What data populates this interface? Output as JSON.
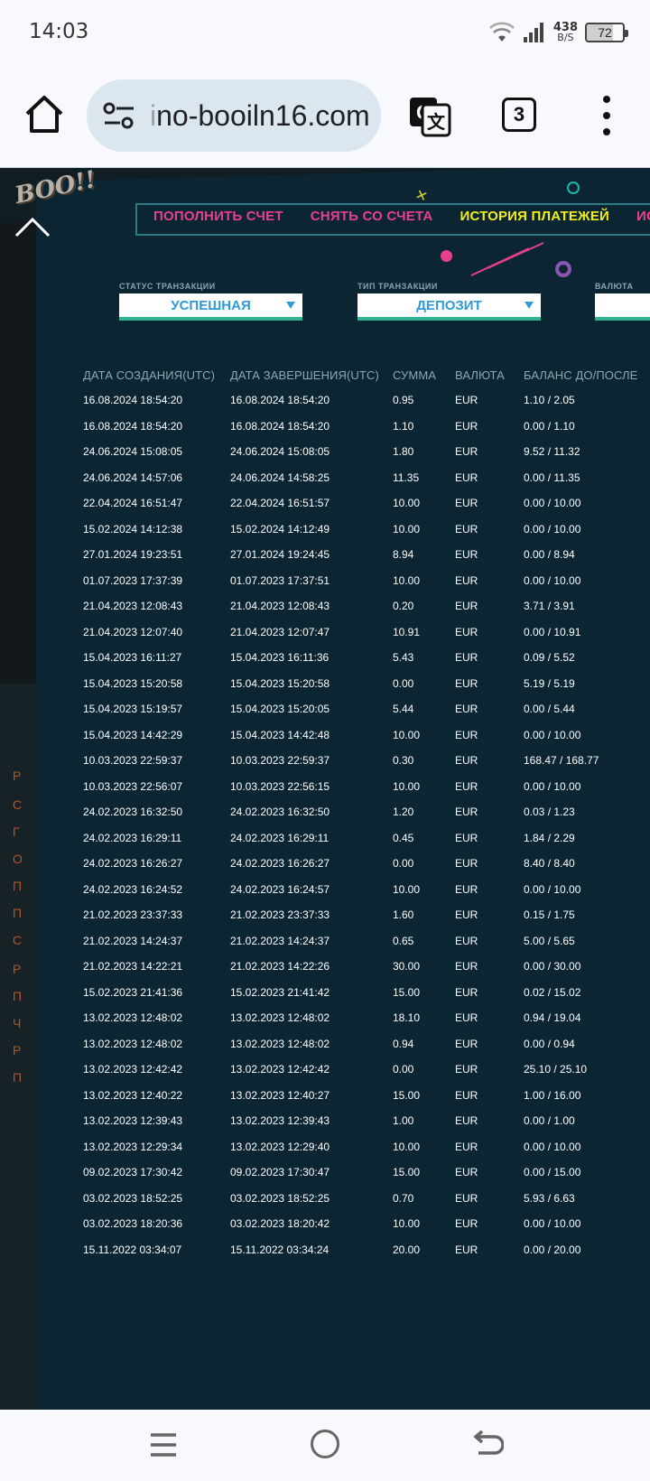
{
  "status_bar": {
    "time": "14:03",
    "net_speed_value": "438",
    "net_speed_unit": "B/S",
    "battery": "72"
  },
  "browser": {
    "url_faded": "i",
    "url": "no-booiln16.com",
    "tab_count": "3"
  },
  "page": {
    "tabs": [
      {
        "label": "ПОПОЛНИТЬ СЧЕТ",
        "active": false
      },
      {
        "label": "СНЯТЬ СО СЧЕТА",
        "active": false
      },
      {
        "label": "ИСТОРИЯ ПЛАТЕЖЕЙ",
        "active": true
      },
      {
        "label": "ИСТО",
        "active": false
      }
    ],
    "filters": [
      {
        "label": "СТАТУС ТРАНЗАКЦИИ",
        "value": "УСПЕШНАЯ"
      },
      {
        "label": "ТИП ТРАНЗАКЦИИ",
        "value": "ДЕПОЗИТ"
      },
      {
        "label": "ВАЛЮТА",
        "value": ""
      }
    ],
    "table": {
      "headers": [
        "ДАТА СОЗДАНИЯ(UTC)",
        "ДАТА ЗАВЕРШЕНИЯ(UTC)",
        "СУММА",
        "ВАЛЮТА",
        "БАЛАНС ДО/ПОСЛЕ"
      ],
      "rows": [
        [
          "16.08.2024 18:54:20",
          "16.08.2024 18:54:20",
          "0.95",
          "EUR",
          "1.10 / 2.05"
        ],
        [
          "16.08.2024 18:54:20",
          "16.08.2024 18:54:20",
          "1.10",
          "EUR",
          "0.00 / 1.10"
        ],
        [
          "24.06.2024 15:08:05",
          "24.06.2024 15:08:05",
          "1.80",
          "EUR",
          "9.52 / 11.32"
        ],
        [
          "24.06.2024 14:57:06",
          "24.06.2024 14:58:25",
          "11.35",
          "EUR",
          "0.00 / 11.35"
        ],
        [
          "22.04.2024 16:51:47",
          "22.04.2024 16:51:57",
          "10.00",
          "EUR",
          "0.00 / 10.00"
        ],
        [
          "15.02.2024 14:12:38",
          "15.02.2024 14:12:49",
          "10.00",
          "EUR",
          "0.00 / 10.00"
        ],
        [
          "27.01.2024 19:23:51",
          "27.01.2024 19:24:45",
          "8.94",
          "EUR",
          "0.00 / 8.94"
        ],
        [
          "01.07.2023 17:37:39",
          "01.07.2023 17:37:51",
          "10.00",
          "EUR",
          "0.00 / 10.00"
        ],
        [
          "21.04.2023 12:08:43",
          "21.04.2023 12:08:43",
          "0.20",
          "EUR",
          "3.71 / 3.91"
        ],
        [
          "21.04.2023 12:07:40",
          "21.04.2023 12:07:47",
          "10.91",
          "EUR",
          "0.00 / 10.91"
        ],
        [
          "15.04.2023 16:11:27",
          "15.04.2023 16:11:36",
          "5.43",
          "EUR",
          "0.09 / 5.52"
        ],
        [
          "15.04.2023 15:20:58",
          "15.04.2023 15:20:58",
          "0.00",
          "EUR",
          "5.19 / 5.19"
        ],
        [
          "15.04.2023 15:19:57",
          "15.04.2023 15:20:05",
          "5.44",
          "EUR",
          "0.00 / 5.44"
        ],
        [
          "15.04.2023 14:42:29",
          "15.04.2023 14:42:48",
          "10.00",
          "EUR",
          "0.00 / 10.00"
        ],
        [
          "10.03.2023 22:59:37",
          "10.03.2023 22:59:37",
          "0.30",
          "EUR",
          "168.47 / 168.77"
        ],
        [
          "10.03.2023 22:56:07",
          "10.03.2023 22:56:15",
          "10.00",
          "EUR",
          "0.00 / 10.00"
        ],
        [
          "24.02.2023 16:32:50",
          "24.02.2023 16:32:50",
          "1.20",
          "EUR",
          "0.03 / 1.23"
        ],
        [
          "24.02.2023 16:29:11",
          "24.02.2023 16:29:11",
          "0.45",
          "EUR",
          "1.84 / 2.29"
        ],
        [
          "24.02.2023 16:26:27",
          "24.02.2023 16:26:27",
          "0.00",
          "EUR",
          "8.40 / 8.40"
        ],
        [
          "24.02.2023 16:24:52",
          "24.02.2023 16:24:57",
          "10.00",
          "EUR",
          "0.00 / 10.00"
        ],
        [
          "21.02.2023 23:37:33",
          "21.02.2023 23:37:33",
          "1.60",
          "EUR",
          "0.15 / 1.75"
        ],
        [
          "21.02.2023 14:24:37",
          "21.02.2023 14:24:37",
          "0.65",
          "EUR",
          "5.00 / 5.65"
        ],
        [
          "21.02.2023 14:22:21",
          "21.02.2023 14:22:26",
          "30.00",
          "EUR",
          "0.00 / 30.00"
        ],
        [
          "15.02.2023 21:41:36",
          "15.02.2023 21:41:42",
          "15.00",
          "EUR",
          "0.02 / 15.02"
        ],
        [
          "13.02.2023 12:48:02",
          "13.02.2023 12:48:02",
          "18.10",
          "EUR",
          "0.94 / 19.04"
        ],
        [
          "13.02.2023 12:48:02",
          "13.02.2023 12:48:02",
          "0.94",
          "EUR",
          "0.00 / 0.94"
        ],
        [
          "13.02.2023 12:42:42",
          "13.02.2023 12:42:42",
          "0.00",
          "EUR",
          "25.10 / 25.10"
        ],
        [
          "13.02.2023 12:40:22",
          "13.02.2023 12:40:27",
          "15.00",
          "EUR",
          "1.00 / 16.00"
        ],
        [
          "13.02.2023 12:39:43",
          "13.02.2023 12:39:43",
          "1.00",
          "EUR",
          "0.00 / 1.00"
        ],
        [
          "13.02.2023 12:29:34",
          "13.02.2023 12:29:40",
          "10.00",
          "EUR",
          "0.00 / 10.00"
        ],
        [
          "09.02.2023 17:30:42",
          "09.02.2023 17:30:47",
          "15.00",
          "EUR",
          "0.00 / 15.00"
        ],
        [
          "03.02.2023 18:52:25",
          "03.02.2023 18:52:25",
          "0.70",
          "EUR",
          "5.93 / 6.63"
        ],
        [
          "03.02.2023 18:20:36",
          "03.02.2023 18:20:42",
          "10.00",
          "EUR",
          "0.00 / 10.00"
        ],
        [
          "15.11.2022 03:34:07",
          "15.11.2022 03:34:24",
          "20.00",
          "EUR",
          "0.00 / 20.00"
        ]
      ]
    },
    "logo_text": "BOO!!",
    "left_fragments": [
      "Р",
      "С",
      "Г",
      "О",
      "П",
      "П",
      "С",
      "Р",
      "П",
      "Ч",
      "Р",
      "П"
    ]
  },
  "colors": {
    "tab_inactive": "#e8418b",
    "tab_active": "#f4ee1e",
    "select_text": "#2f9ad6",
    "select_underline": "#2fb38e"
  }
}
